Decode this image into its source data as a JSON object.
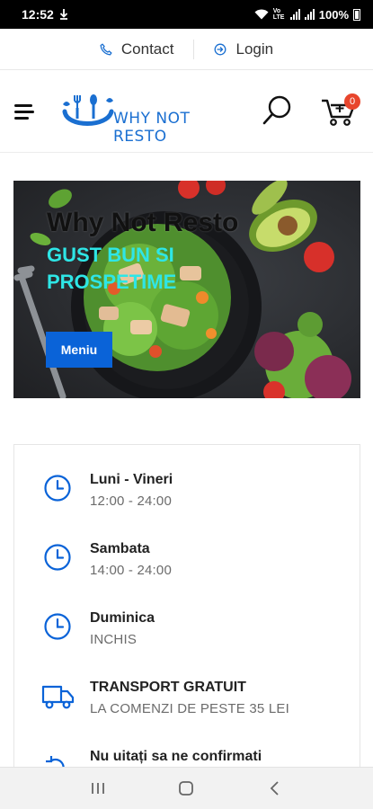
{
  "status_bar": {
    "time": "12:52",
    "battery": "100%",
    "network": "Vo LTE"
  },
  "top_links": {
    "contact": "Contact",
    "login": "Login"
  },
  "header": {
    "logo_text": "WHY NOT RESTO",
    "cart_count": "0"
  },
  "hero": {
    "title": "Why Not Resto",
    "subtitle_line1": "GUST BUN SI",
    "subtitle_line2": "PROSPETIME",
    "button": "Meniu"
  },
  "hours": [
    {
      "title": "Luni - Vineri",
      "detail": "12:00 - 24:00",
      "icon": "clock-icon"
    },
    {
      "title": "Sambata",
      "detail": "14:00 - 24:00",
      "icon": "clock-icon"
    },
    {
      "title": "Duminica",
      "detail": "INCHIS",
      "icon": "clock-icon"
    },
    {
      "title": "TRANSPORT GRATUIT",
      "detail": "LA COMENZI DE PESTE 35 LEI",
      "icon": "truck-icon"
    },
    {
      "title": "Nu uitați sa ne confirmati",
      "detail": "",
      "icon": "refresh-icon"
    }
  ],
  "colors": {
    "accent": "#0a63d8",
    "logo": "#1a6fd1",
    "subtitle": "#2ee6e6",
    "badge": "#e8452c"
  }
}
